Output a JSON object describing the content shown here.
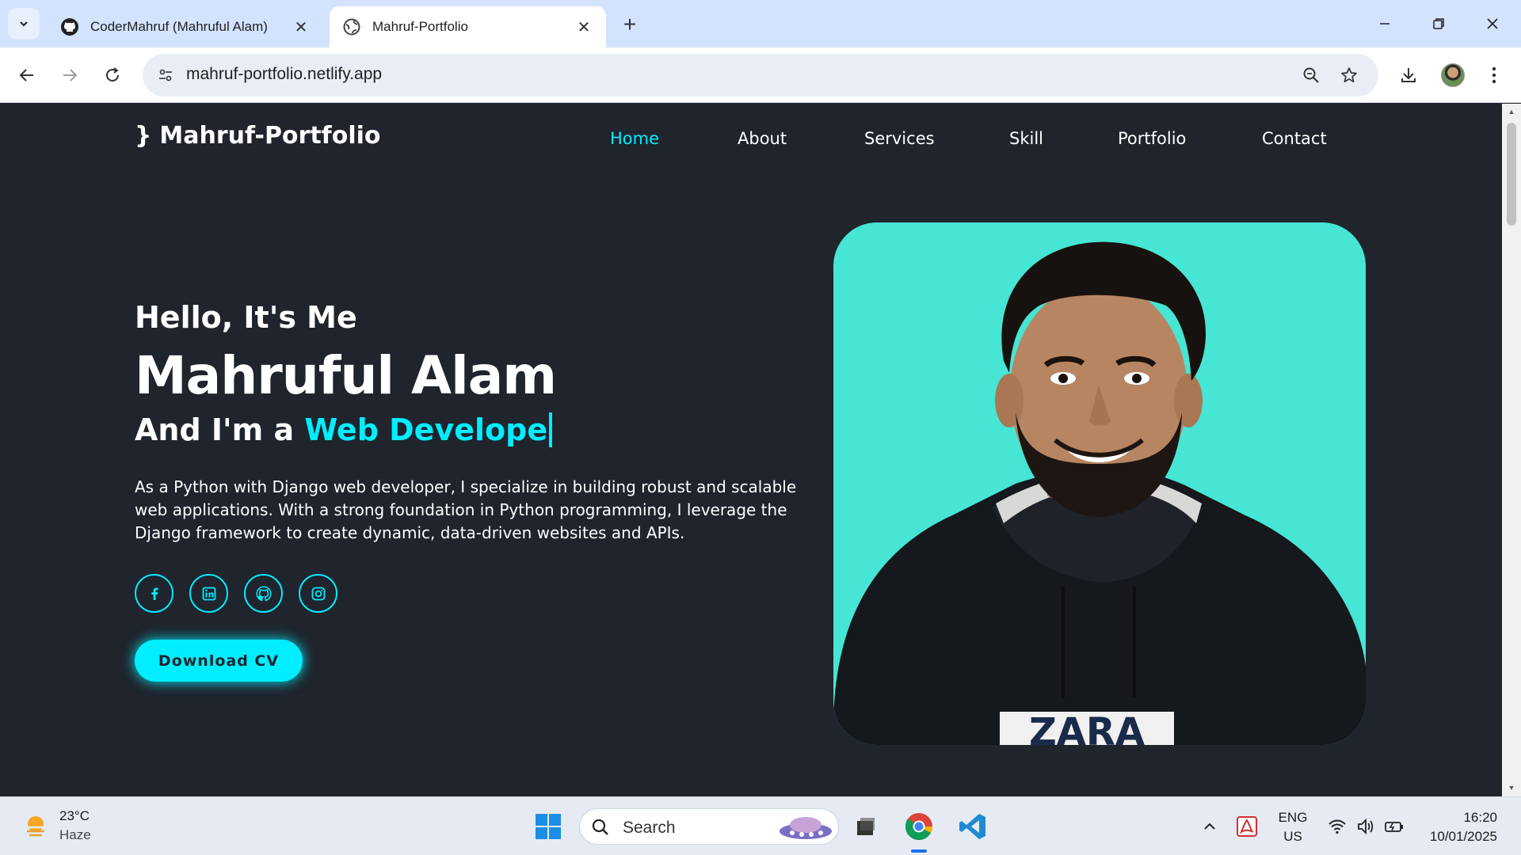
{
  "browser": {
    "tabs": [
      {
        "title": "CoderMahruf (Mahruful Alam)",
        "icon": "github-icon",
        "active": false
      },
      {
        "title": "Mahruf-Portfolio",
        "icon": "globe-icon",
        "active": true
      }
    ],
    "url": "mahruf-portfolio.netlify.app"
  },
  "site": {
    "logo_brace": "}",
    "logo_text": "Mahruf-Portfolio",
    "nav": [
      {
        "label": "Home",
        "active": true
      },
      {
        "label": "About",
        "active": false
      },
      {
        "label": "Services",
        "active": false
      },
      {
        "label": "Skill",
        "active": false
      },
      {
        "label": "Portfolio",
        "active": false
      },
      {
        "label": "Contact",
        "active": false
      }
    ],
    "hero": {
      "greeting": "Hello, It's Me",
      "name": "Mahruful Alam",
      "role_prefix": "And I'm a",
      "role_typed": "Web Develope",
      "description": "As a Python with Django web developer, I specialize in building robust and scalable web applications. With a strong foundation in Python programming, I leverage the Django framework to create dynamic, data-driven websites and APIs.",
      "socials": [
        "facebook-icon",
        "linkedin-icon",
        "github-icon",
        "instagram-icon"
      ],
      "cta": "Download CV"
    },
    "accent_color": "#00eeff",
    "background_color": "#1f242d",
    "photo_bg_color": "#47e5d3",
    "shirt_text": "ZARA"
  },
  "taskbar": {
    "weather_temp": "23°C",
    "weather_desc": "Haze",
    "search_label": "Search",
    "lang_top": "ENG",
    "lang_bottom": "US",
    "time": "16:20",
    "date": "10/01/2025"
  }
}
